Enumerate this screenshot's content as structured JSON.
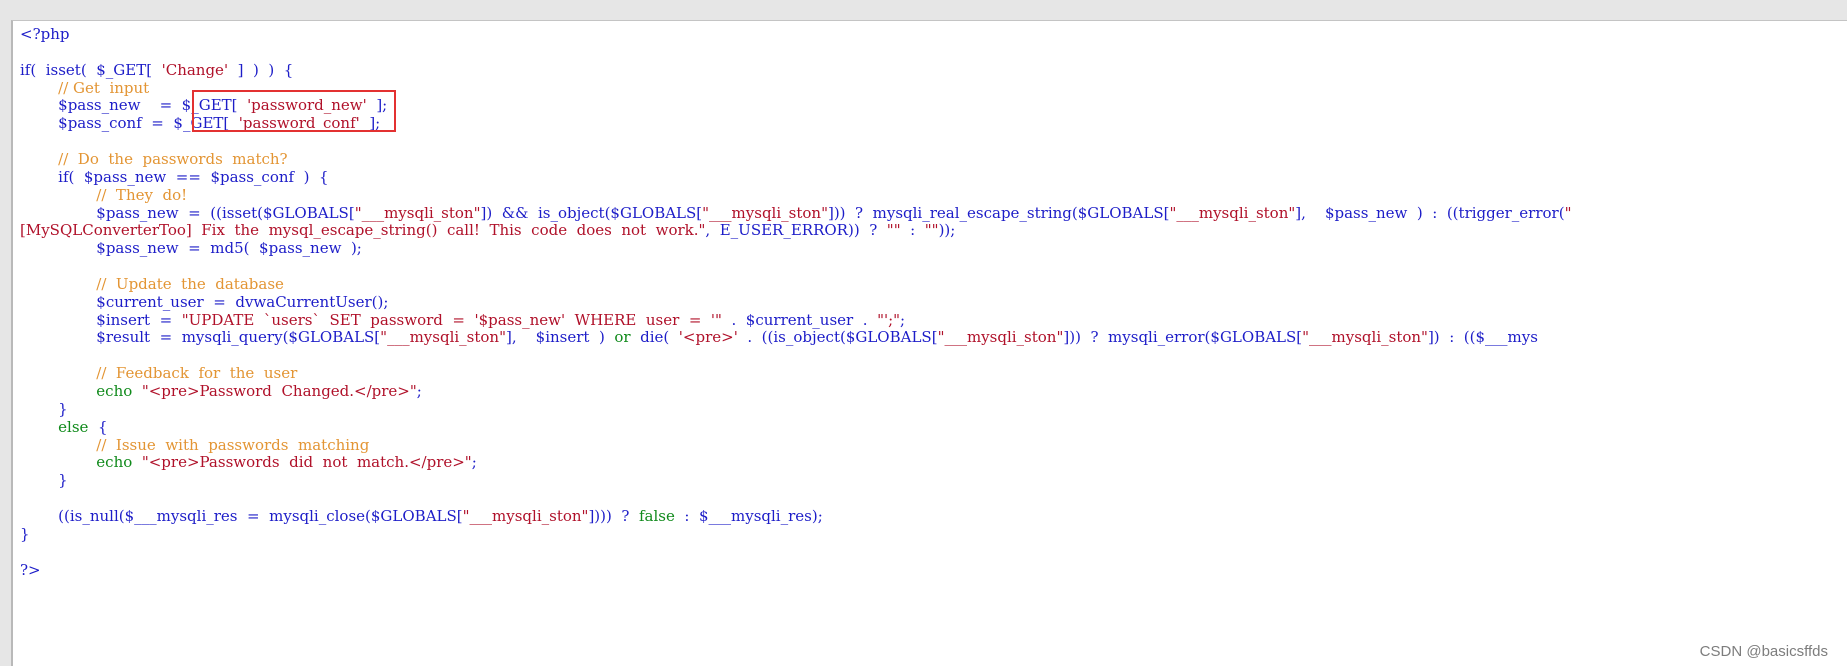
{
  "code": {
    "lines": [
      {
        "id": 1,
        "parts": [
          {
            "t": "<?php",
            "c": "blue"
          }
        ]
      },
      {
        "id": 2,
        "parts": [
          {
            "t": "",
            "c": "blue"
          }
        ]
      },
      {
        "id": 3,
        "parts": [
          {
            "t": "if(  isset(  $_GET[  ",
            "c": "blue"
          },
          {
            "t": "'Change'",
            "c": "str"
          },
          {
            "t": "  ]  )  )  {",
            "c": "blue"
          }
        ]
      },
      {
        "id": 4,
        "parts": [
          {
            "t": "        // Get  input",
            "c": "cmt"
          }
        ]
      },
      {
        "id": 5,
        "parts": [
          {
            "t": "        $pass_new    =  $_GET[  ",
            "c": "blue"
          },
          {
            "t": "'password_new'",
            "c": "str"
          },
          {
            "t": "  ];",
            "c": "blue"
          }
        ]
      },
      {
        "id": 6,
        "parts": [
          {
            "t": "        $pass_conf  =  $_GET[  ",
            "c": "blue"
          },
          {
            "t": "'password_conf'",
            "c": "str"
          },
          {
            "t": "  ];",
            "c": "blue"
          }
        ]
      },
      {
        "id": 7,
        "parts": [
          {
            "t": "",
            "c": "blue"
          }
        ]
      },
      {
        "id": 8,
        "parts": [
          {
            "t": "        //  Do  the  passwords  match?",
            "c": "cmt"
          }
        ]
      },
      {
        "id": 9,
        "parts": [
          {
            "t": "        if(  $pass_new  ==  $pass_conf  )  {",
            "c": "blue"
          }
        ]
      },
      {
        "id": 10,
        "parts": [
          {
            "t": "                //  They  do!",
            "c": "cmt"
          }
        ]
      },
      {
        "id": 11,
        "parts": [
          {
            "t": "                $pass_new  =  ((isset($GLOBALS[",
            "c": "blue"
          },
          {
            "t": "\"___mysqli_ston\"",
            "c": "str"
          },
          {
            "t": "])  &&  is_object($GLOBALS[",
            "c": "blue"
          },
          {
            "t": "\"___mysqli_ston\"",
            "c": "str"
          },
          {
            "t": "]))  ?  mysqli_real_escape_string($GLOBALS[",
            "c": "blue"
          },
          {
            "t": "\"___mysqli_ston\"",
            "c": "str"
          },
          {
            "t": "],    $pass_new  )  :  ((trigger_error(",
            "c": "blue"
          },
          {
            "t": "\"",
            "c": "str"
          }
        ]
      },
      {
        "id": 12,
        "parts": [
          {
            "t": "[MySQLConverterToo]  Fix  the  mysql_escape_string()  call!  This  code  does  not  work.\"",
            "c": "str"
          },
          {
            "t": ",  E_USER_ERROR))  ?  ",
            "c": "blue"
          },
          {
            "t": "\"\"",
            "c": "str"
          },
          {
            "t": "  :  ",
            "c": "blue"
          },
          {
            "t": "\"\"",
            "c": "str"
          },
          {
            "t": "));",
            "c": "blue"
          }
        ]
      },
      {
        "id": 13,
        "parts": [
          {
            "t": "                $pass_new  =  md5(  $pass_new  );",
            "c": "blue"
          }
        ]
      },
      {
        "id": 14,
        "parts": [
          {
            "t": "",
            "c": "blue"
          }
        ]
      },
      {
        "id": 15,
        "parts": [
          {
            "t": "                //  Update  the  database",
            "c": "cmt"
          }
        ]
      },
      {
        "id": 16,
        "parts": [
          {
            "t": "                $current_user  =  dvwaCurrentUser();",
            "c": "blue"
          }
        ]
      },
      {
        "id": 17,
        "parts": [
          {
            "t": "                $insert  =  ",
            "c": "blue"
          },
          {
            "t": "\"UPDATE  `users`  SET  password  =  '$pass_new'  WHERE  user  =  '\"",
            "c": "str"
          },
          {
            "t": "  .  $current_user  .  ",
            "c": "blue"
          },
          {
            "t": "\"';\"",
            "c": "str"
          },
          {
            "t": ";",
            "c": "blue"
          }
        ]
      },
      {
        "id": 18,
        "parts": [
          {
            "t": "                $result  =  mysqli_query($GLOBALS[",
            "c": "blue"
          },
          {
            "t": "\"___mysqli_ston\"",
            "c": "str"
          },
          {
            "t": "],    $insert  )  ",
            "c": "blue"
          },
          {
            "t": "or",
            "c": "grn"
          },
          {
            "t": "  die(  ",
            "c": "blue"
          },
          {
            "t": "'<pre>'",
            "c": "str"
          },
          {
            "t": "  .  ((is_object($GLOBALS[",
            "c": "blue"
          },
          {
            "t": "\"___mysqli_ston\"",
            "c": "str"
          },
          {
            "t": "]))  ?  mysqli_error($GLOBALS[",
            "c": "blue"
          },
          {
            "t": "\"___mysqli_ston\"",
            "c": "str"
          },
          {
            "t": "])  :  (($___mys",
            "c": "blue"
          }
        ]
      },
      {
        "id": 19,
        "parts": [
          {
            "t": "",
            "c": "blue"
          }
        ]
      },
      {
        "id": 20,
        "parts": [
          {
            "t": "                //  Feedback  for  the  user",
            "c": "cmt"
          }
        ]
      },
      {
        "id": 21,
        "parts": [
          {
            "t": "                ",
            "c": "blue"
          },
          {
            "t": "echo",
            "c": "grn"
          },
          {
            "t": "  ",
            "c": "blue"
          },
          {
            "t": "\"<pre>Password  Changed.</pre>\"",
            "c": "str"
          },
          {
            "t": ";",
            "c": "blue"
          }
        ]
      },
      {
        "id": 22,
        "parts": [
          {
            "t": "        }",
            "c": "blue"
          }
        ]
      },
      {
        "id": 23,
        "parts": [
          {
            "t": "        ",
            "c": "blue"
          },
          {
            "t": "else",
            "c": "grn"
          },
          {
            "t": "  {",
            "c": "blue"
          }
        ]
      },
      {
        "id": 24,
        "parts": [
          {
            "t": "                //  Issue  with  passwords  matching",
            "c": "cmt"
          }
        ]
      },
      {
        "id": 25,
        "parts": [
          {
            "t": "                ",
            "c": "blue"
          },
          {
            "t": "echo",
            "c": "grn"
          },
          {
            "t": "  ",
            "c": "blue"
          },
          {
            "t": "\"<pre>Passwords  did  not  match.</pre>\"",
            "c": "str"
          },
          {
            "t": ";",
            "c": "blue"
          }
        ]
      },
      {
        "id": 26,
        "parts": [
          {
            "t": "        }",
            "c": "blue"
          }
        ]
      },
      {
        "id": 27,
        "parts": [
          {
            "t": "",
            "c": "blue"
          }
        ]
      },
      {
        "id": 28,
        "parts": [
          {
            "t": "        ((is_null($___mysqli_res  =  mysqli_close($GLOBALS[",
            "c": "blue"
          },
          {
            "t": "\"___mysqli_ston\"",
            "c": "str"
          },
          {
            "t": "])))  ?  ",
            "c": "blue"
          },
          {
            "t": "false",
            "c": "grn"
          },
          {
            "t": "  :  $___mysqli_res);",
            "c": "blue"
          }
        ]
      },
      {
        "id": 29,
        "parts": [
          {
            "t": "}",
            "c": "blue"
          }
        ]
      },
      {
        "id": 30,
        "parts": [
          {
            "t": "",
            "c": "blue"
          }
        ]
      },
      {
        "id": 31,
        "parts": [
          {
            "t": "?>",
            "c": "blue"
          }
        ]
      }
    ]
  },
  "watermark": "CSDN @basicsffds",
  "colors": {
    "keyword": "#1d1dc8",
    "string": "#b0112a",
    "comment": "#e39534",
    "highlight_border": "#e33131"
  }
}
